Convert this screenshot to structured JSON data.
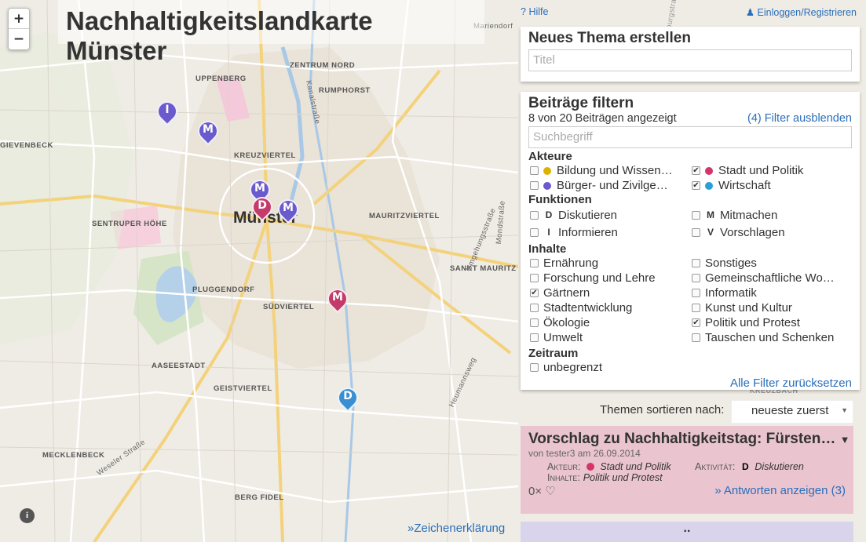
{
  "map": {
    "title": "Nachhaltigkeitslandkarte Münster",
    "city_label": "Münster",
    "zoom_in": "+",
    "zoom_out": "−",
    "info_label": "i",
    "legend_link": "»Zeichenerklärung",
    "district_labels": [
      "ZENTRUM NORD",
      "UPPENBERG",
      "RUMPHORST",
      "KREUZVIERTEL",
      "GIEVENBECK",
      "SENTRUPER HÖHE",
      "MAURITZVIERTEL",
      "SANKT MAURITZ",
      "PLUGGENDORF",
      "SÜDVIERTEL",
      "AASEESTADT",
      "GEISTVIERTEL",
      "MECKLENBECK",
      "BERG FIDEL",
      "KREUZBACH"
    ],
    "street_labels": [
      "Kanalstraße",
      "Umgehungsstraße",
      "Mondstraße",
      "Heumannsweg",
      "Weseler Straße",
      "Wienburgstraße",
      "Mariendorf"
    ],
    "markers": [
      {
        "letter": "I",
        "color": "#6a5acd"
      },
      {
        "letter": "M",
        "color": "#6a5acd"
      },
      {
        "letter": "M",
        "color": "#6a5acd"
      },
      {
        "letter": "D",
        "color": "#c43a6b"
      },
      {
        "letter": "M",
        "color": "#6a5acd"
      },
      {
        "letter": "M",
        "color": "#c43a6b"
      },
      {
        "letter": "D",
        "color": "#3a8fd0"
      }
    ]
  },
  "header": {
    "help": "Hilfe",
    "login": "Einloggen/Registrieren"
  },
  "new_topic": {
    "heading": "Neues Thema erstellen",
    "title_placeholder": "Titel"
  },
  "filter": {
    "heading": "Beiträge filtern",
    "count_text": "8 von 20 Beiträgen angezeigt",
    "hide_link": "(4) Filter ausblenden",
    "search_placeholder": "Suchbegriff",
    "actors_heading": "Akteure",
    "actors": [
      {
        "label": "Bildung und Wissen…",
        "color": "#e0b000",
        "checked": false
      },
      {
        "label": "Stadt und Politik",
        "color": "#d6336c",
        "checked": true
      },
      {
        "label": "Bürger- und Zivilge…",
        "color": "#6a5acd",
        "checked": false
      },
      {
        "label": "Wirtschaft",
        "color": "#2a9fd6",
        "checked": true
      }
    ],
    "functions_heading": "Funktionen",
    "functions": [
      {
        "letter": "D",
        "label": "Diskutieren",
        "checked": false
      },
      {
        "letter": "M",
        "label": "Mitmachen",
        "checked": false
      },
      {
        "letter": "I",
        "label": "Informieren",
        "checked": false
      },
      {
        "letter": "V",
        "label": "Vorschlagen",
        "checked": false
      }
    ],
    "contents_heading": "Inhalte",
    "contents": [
      {
        "label": "Ernährung",
        "checked": false
      },
      {
        "label": "Sonstiges",
        "checked": false
      },
      {
        "label": "Forschung und Lehre",
        "checked": false
      },
      {
        "label": "Gemeinschaftliche Wo…",
        "checked": false
      },
      {
        "label": "Gärtnern",
        "checked": true
      },
      {
        "label": "Informatik",
        "checked": false
      },
      {
        "label": "Stadtentwicklung",
        "checked": false
      },
      {
        "label": "Kunst und Kultur",
        "checked": false
      },
      {
        "label": "Ökologie",
        "checked": false
      },
      {
        "label": "Politik und Protest",
        "checked": true
      },
      {
        "label": "Umwelt",
        "checked": false
      },
      {
        "label": "Tauschen und Schenken",
        "checked": false
      }
    ],
    "period_heading": "Zeitraum",
    "period_label": "unbegrenzt",
    "reset_link": "Alle Filter zurücksetzen"
  },
  "sort": {
    "label": "Themen sortieren nach:",
    "value": "neueste zuerst"
  },
  "post": {
    "title": "Vorschlag zu Nachhaltigkeitstag: Fürsten…",
    "byline": "von tester3 am 26.09.2014",
    "actor_label": "Akteur:",
    "actor_value": "Stadt und Politik",
    "actor_color": "#d6336c",
    "activity_label": "Aktivität:",
    "activity_letter": "D",
    "activity_value": "Diskutieren",
    "contents_label": "Inhalte:",
    "contents_value": "Politik und Protest",
    "likes": "0×",
    "replies_link": "» Antworten anzeigen (3)"
  },
  "next_post_peek": ".."
}
